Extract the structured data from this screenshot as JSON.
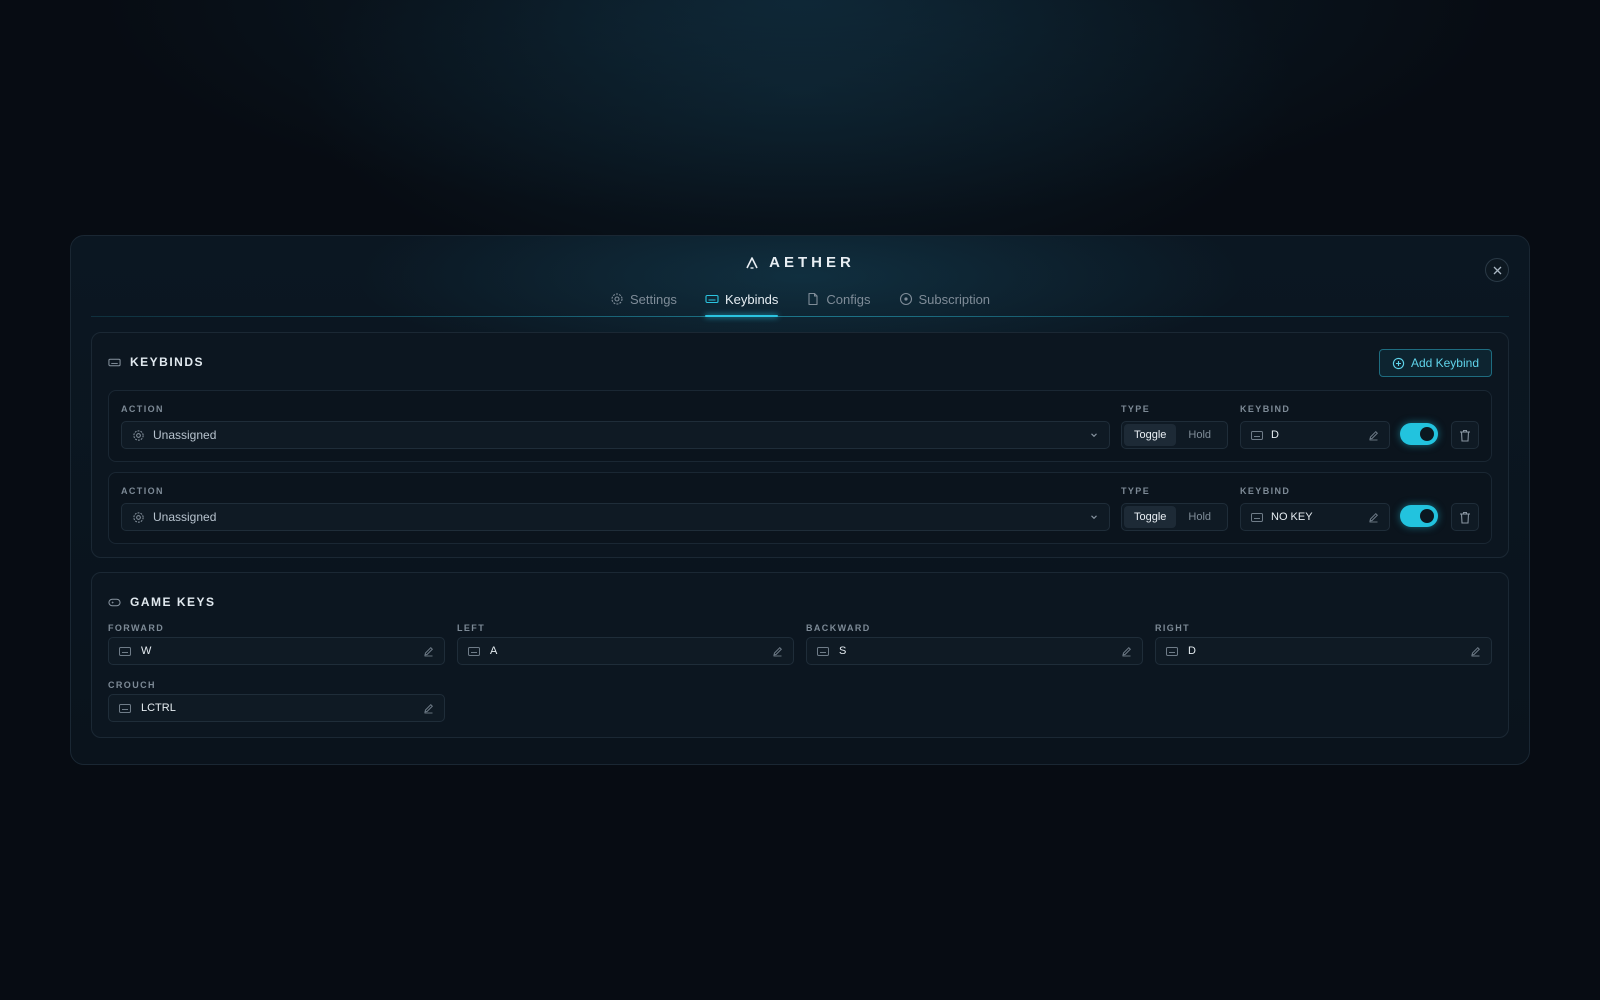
{
  "app": {
    "name": "AETHER"
  },
  "tabs": [
    {
      "label": "Settings",
      "icon": "gear-icon",
      "active": false
    },
    {
      "label": "Keybinds",
      "icon": "keyboard-icon",
      "active": true
    },
    {
      "label": "Configs",
      "icon": "file-icon",
      "active": false
    },
    {
      "label": "Subscription",
      "icon": "plus-circle-icon",
      "active": false
    }
  ],
  "keybinds": {
    "title": "KEYBINDS",
    "add_label": "Add Keybind",
    "action_label": "ACTION",
    "type_label": "TYPE",
    "keybind_label": "KEYBIND",
    "type_options": [
      "Toggle",
      "Hold"
    ],
    "rows": [
      {
        "action": "Unassigned",
        "type": "Toggle",
        "key": "D",
        "enabled": true
      },
      {
        "action": "Unassigned",
        "type": "Toggle",
        "key": "NO KEY",
        "enabled": true
      }
    ]
  },
  "game_keys": {
    "title": "GAME KEYS",
    "items": [
      {
        "label": "FORWARD",
        "key": "W"
      },
      {
        "label": "LEFT",
        "key": "A"
      },
      {
        "label": "BACKWARD",
        "key": "S"
      },
      {
        "label": "RIGHT",
        "key": "D"
      },
      {
        "label": "CROUCH",
        "key": "LCTRL"
      }
    ]
  },
  "colors": {
    "accent": "#2bc4e0",
    "background": "#070c13",
    "panel": "#0c1620"
  }
}
